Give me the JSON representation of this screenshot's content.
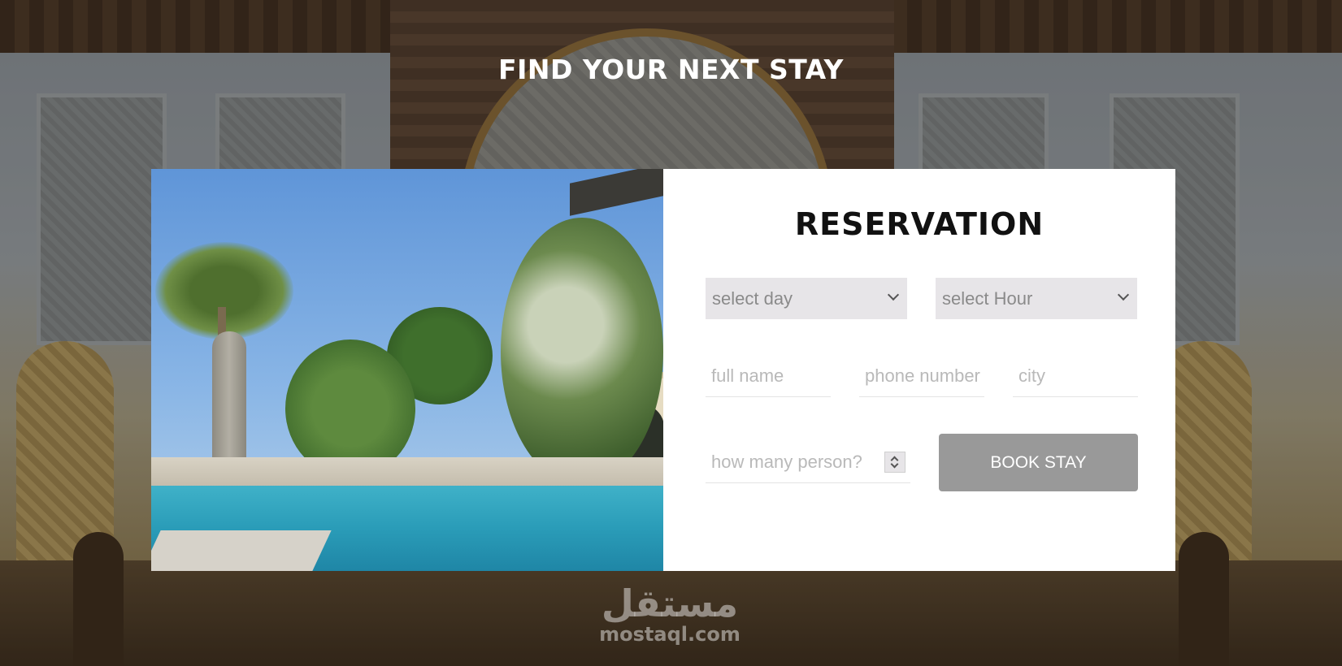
{
  "hero": {
    "title": "FIND YOUR NEXT STAY"
  },
  "reservation": {
    "title": "RESERVATION",
    "day_select": {
      "value": "select day"
    },
    "hour_select": {
      "value": "select Hour"
    },
    "full_name": {
      "placeholder": "full name"
    },
    "phone": {
      "placeholder": "phone number"
    },
    "city": {
      "placeholder": "city"
    },
    "persons": {
      "placeholder": "how many person?"
    },
    "book_button": "BOOK STAY"
  },
  "watermark": {
    "arabic": "مستقل",
    "latin": "mostaql.com"
  },
  "colors": {
    "card_bg": "#ffffff",
    "select_bg": "#e7e5e8",
    "button_bg": "#999999",
    "title_color": "#111111"
  },
  "icons": [
    "chevron-down-icon",
    "chevron-down-icon",
    "number-spinner-icon"
  ]
}
